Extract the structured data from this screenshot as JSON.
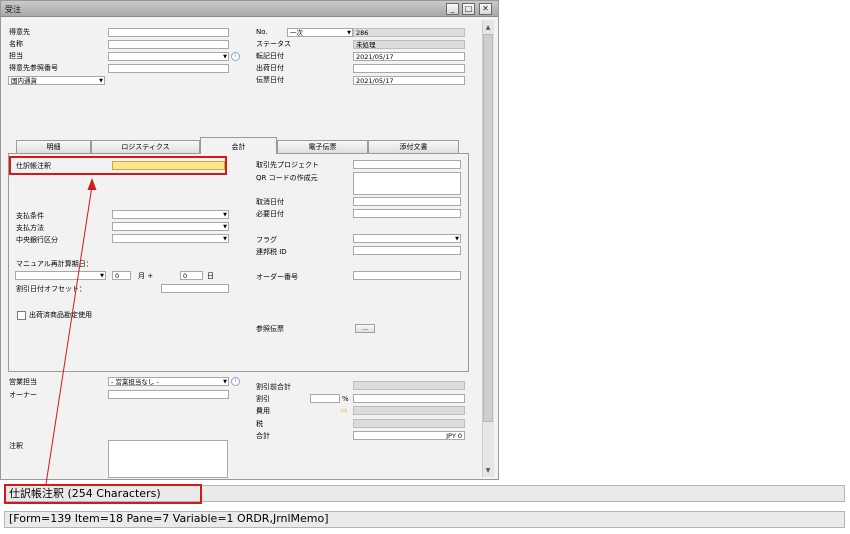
{
  "window": {
    "title": "受注",
    "controls": {
      "minimize": "_",
      "maximize": "□",
      "close": "✕"
    }
  },
  "header_left": {
    "labels": [
      "得意先",
      "名称",
      "担当",
      "得意先参照番号"
    ],
    "currency_select": "国内通貨"
  },
  "header_right": {
    "no_label": "No.",
    "series": "一次",
    "doc_number": "286",
    "status_label": "ステータス",
    "status": "未処理",
    "posting_date_label": "転記日付",
    "posting_date": "2021/05/17",
    "delivery_date_label": "出荷日付",
    "doc_date_label": "伝票日付",
    "doc_date": "2021/05/17"
  },
  "tabs": [
    "明細",
    "ロジスティクス",
    "会計",
    "電子伝票",
    "添付文書"
  ],
  "accounting": {
    "journal_remarks_label": "仕訳帳注釈",
    "payment_terms_label": "支払条件",
    "payment_method_label": "支払方法",
    "central_bank_label": "中央銀行区分",
    "manual_recalc_label": "マニュアル再計算期日：",
    "recalc_days": "0",
    "month_label": "月 +",
    "day_value": "0",
    "day_label": "日",
    "discount_offset_label": "割引日付オフセット：",
    "bp_project_label": "取引先プロジェクト",
    "qr_label": "QR コードの作成元",
    "cancel_date_label": "取消日付",
    "required_date_label": "必要日付",
    "flag_label": "フラグ",
    "federal_tax_label": "連邦税 ID",
    "order_number_label": "オーダー番号",
    "ref_doc_label": "参照伝票",
    "ref_doc_button": "...",
    "use_shipped_goods_label": "出荷済商品勘定使用"
  },
  "footer": {
    "sales_emp_label": "営業担当",
    "sales_emp_value": "- 営業担当なし -",
    "owner_label": "オーナー",
    "remarks_label": "注釈",
    "total_before_disc_label": "割引前合計",
    "discount_label": "割引",
    "percent": "%",
    "freight_label": "費用",
    "tax_label": "税",
    "total_label": "合計",
    "total_value": "JPY 0"
  },
  "statusbar": {
    "field_info": "仕訳帳注釈 (254 Characters)",
    "system_info": "[Form=139 Item=18 Pane=7 Variable=1 ORDR,JrnlMemo]"
  },
  "colors": {
    "highlight": "#ffe58a",
    "annotation": "#d21a1a"
  },
  "icons": [
    "info-icon",
    "link-arrow-icon",
    "dropdown-icon"
  ]
}
